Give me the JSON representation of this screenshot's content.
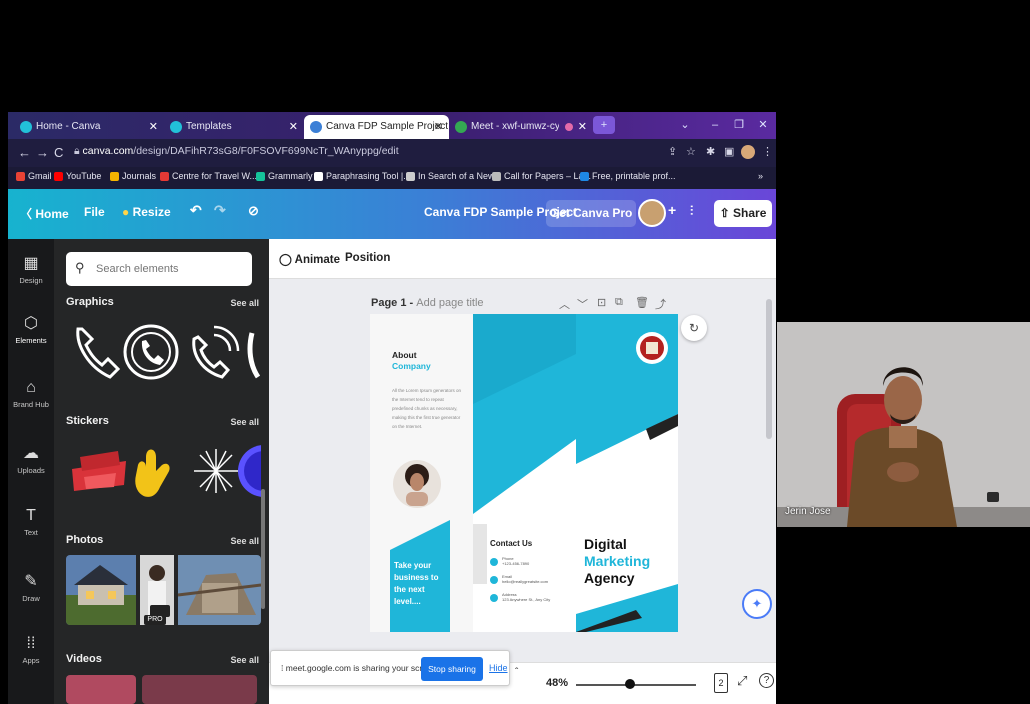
{
  "browser": {
    "tabs": [
      {
        "label": "Home - Canva"
      },
      {
        "label": "Templates"
      },
      {
        "label": "Canva FDP Sample Project - Trifo"
      },
      {
        "label": "Meet - xwf-umwz-cyf"
      }
    ],
    "url_host": "canva.com",
    "url_path": "/design/DAFihR73sG8/F0FSOVF699NcTr_WAnyppg/edit",
    "bookmarks": [
      {
        "label": "Gmail",
        "color": "#ea4335"
      },
      {
        "label": "YouTube",
        "color": "#ff0000"
      },
      {
        "label": "Journals",
        "color": "#f4b400"
      },
      {
        "label": "Centre for Travel W...",
        "color": "#e53935"
      },
      {
        "label": "Grammarly",
        "color": "#15c39a"
      },
      {
        "label": "Paraphrasing Tool |...",
        "color": "#ffffff"
      },
      {
        "label": "In Search of a New...",
        "color": "#cccccc"
      },
      {
        "label": "Call for Papers – La...",
        "color": "#bbbbbb"
      },
      {
        "label": "Free, printable prof...",
        "color": "#1e88e5"
      }
    ]
  },
  "canva_header": {
    "home": "Home",
    "file": "File",
    "resize": "Resize",
    "project_title": "Canva FDP Sample Project",
    "get_pro": "Get Canva Pro",
    "share": "Share"
  },
  "rail": [
    {
      "label": "Design",
      "icon": "▦"
    },
    {
      "label": "Elements",
      "icon": "⬡"
    },
    {
      "label": "Brand Hub",
      "icon": "⌂"
    },
    {
      "label": "Uploads",
      "icon": "☁"
    },
    {
      "label": "Text",
      "icon": "T"
    },
    {
      "label": "Draw",
      "icon": "✎"
    },
    {
      "label": "Apps",
      "icon": "⁞⁞"
    }
  ],
  "panel": {
    "search_placeholder": "Search elements",
    "sections": {
      "graphics": "Graphics",
      "stickers": "Stickers",
      "photos": "Photos",
      "videos": "Videos"
    },
    "see_all": "See all",
    "pro_badge": "PRO"
  },
  "editor": {
    "animate": "Animate",
    "position": "Position",
    "page_label": "Page 1 - ",
    "page_title_placeholder": "Add page title",
    "zoom": "48%",
    "page_count": "2",
    "help": "?"
  },
  "brochure": {
    "about_line1": "About",
    "about_line2": "Company",
    "about_body": "All the Lorem Ipsum generators on the Internet tend to repeat predefined chunks as necessary, making this the first true generator on the Internet.",
    "cta": "Take your business to the next level....",
    "contact_title": "Contact Us",
    "contact_phone_label": "Phone",
    "contact_phone": "+123-456-7890",
    "contact_email_label": "Email",
    "contact_email": "hello@reallygreatsite.com",
    "contact_address_label": "Address",
    "contact_address": "123 Anywhere St., Any City",
    "headline1": "Digital",
    "headline2": "Marketing",
    "headline3": "Agency",
    "accent": "#1fb6d9"
  },
  "sharebar": {
    "message": "meet.google.com is sharing your screen.",
    "stop": "Stop sharing",
    "hide": "Hide"
  },
  "webcam": {
    "name": "Jerin Jose"
  }
}
